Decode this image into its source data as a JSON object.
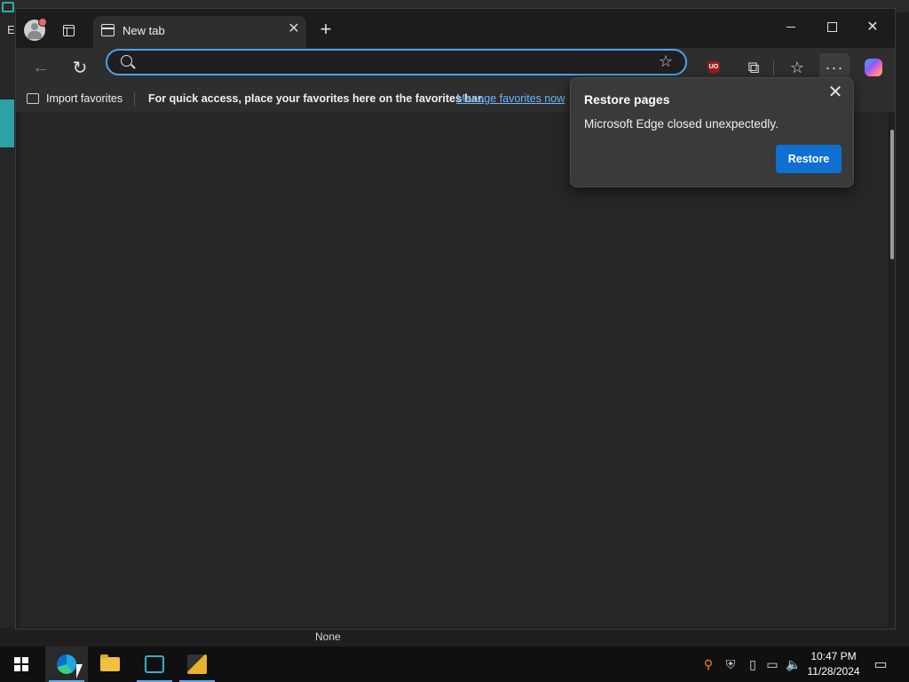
{
  "background_app": {
    "menu_letter": "E",
    "status_text": "None"
  },
  "browser": {
    "tab": {
      "title": "New tab",
      "close": "✕"
    },
    "new_tab": "+",
    "window_controls": {
      "close": "✕"
    },
    "nav": {
      "back": "←",
      "refresh": "↻"
    },
    "address": {
      "value": "",
      "placeholder": ""
    },
    "toolbar_icons": {
      "favorite_star": "☆",
      "ublock_label": "UO",
      "extensions": "⧉",
      "favorites": "☆",
      "more": "···"
    },
    "favorites_bar": {
      "import_label": "Import favorites",
      "hint": "For quick access, place your favorites here on the favorites bar.",
      "manage_link": "Manage favorites now"
    }
  },
  "popup": {
    "title": "Restore pages",
    "message": "Microsoft Edge closed unexpectedly.",
    "restore_button": "Restore",
    "close": "✕"
  },
  "taskbar": {
    "time": "10:47 PM",
    "date": "11/28/2024",
    "tray_icons": [
      "search-icon",
      "shield-icon",
      "battery-icon",
      "network-icon",
      "volume-muted-icon"
    ]
  },
  "colors": {
    "accent": "#1070d2",
    "link": "#6cb6ff",
    "focus": "#4aa3f0"
  }
}
